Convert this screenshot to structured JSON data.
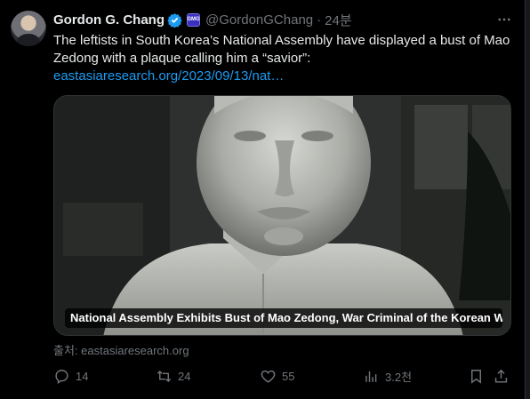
{
  "tweet": {
    "author_name": "Gordon G. Chang",
    "handle": "@GordonGChang",
    "separator": "·",
    "time": "24분",
    "body": "The leftists in South Korea’s National Assembly have displayed a bust of Mao Zedong with a plaque calling him a “savior”:",
    "link": "eastasiaresearch.org/2023/09/13/nat…",
    "media_caption": "National Assembly Exhibits Bust of Mao Zedong, War Criminal of the Korean War...",
    "source": "출처: eastasiaresearch.org",
    "replies": "14",
    "reposts": "24",
    "likes": "55",
    "views": "3.2천"
  },
  "colors": {
    "background": "#000000",
    "text": "#e7e9ea",
    "muted": "#71767b",
    "accent": "#1d9bf0"
  },
  "icons": [
    "verified-badge-icon",
    "affiliate-badge-icon",
    "more-icon",
    "reply-icon",
    "repost-icon",
    "like-icon",
    "views-icon",
    "bookmark-icon",
    "share-icon"
  ]
}
